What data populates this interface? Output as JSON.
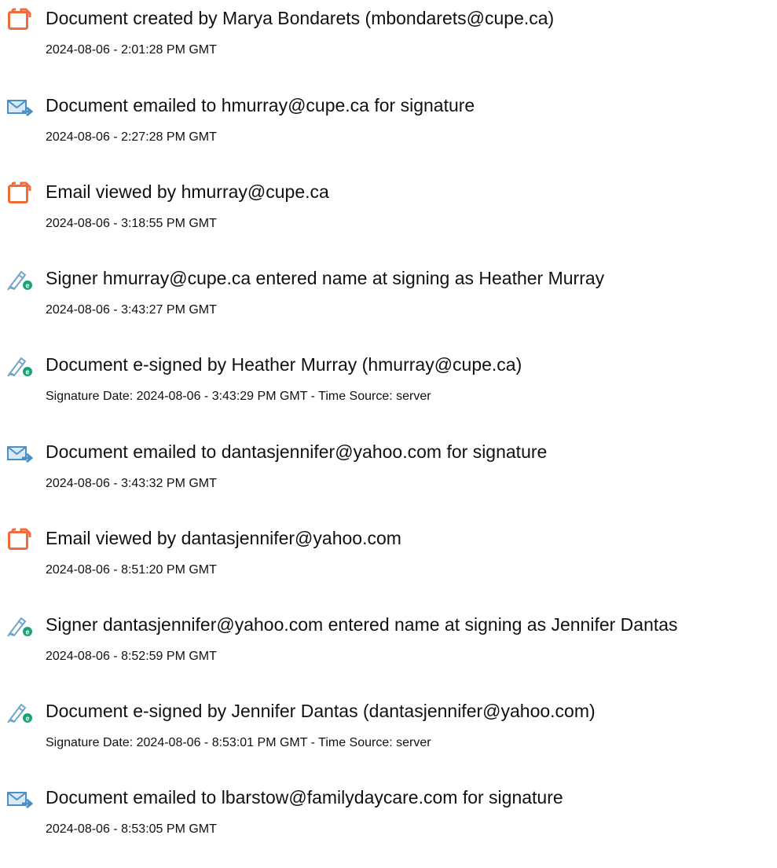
{
  "events": [
    {
      "icon": "document-created-icon",
      "title": "Document created by Marya Bondarets (mbondarets@cupe.ca)",
      "time": "2024-08-06 - 2:01:28 PM GMT"
    },
    {
      "icon": "email-sent-icon",
      "title": "Document emailed to hmurray@cupe.ca for signature",
      "time": "2024-08-06 - 2:27:28 PM GMT"
    },
    {
      "icon": "email-viewed-icon",
      "title": "Email viewed by hmurray@cupe.ca",
      "time": "2024-08-06 - 3:18:55 PM GMT"
    },
    {
      "icon": "e-sign-pen-icon",
      "title": "Signer hmurray@cupe.ca entered name at signing as Heather Murray",
      "time": "2024-08-06 - 3:43:27 PM GMT"
    },
    {
      "icon": "e-sign-pen-icon",
      "title": "Document e-signed by Heather Murray (hmurray@cupe.ca)",
      "time": "Signature Date: 2024-08-06 - 3:43:29 PM GMT - Time Source: server"
    },
    {
      "icon": "email-sent-icon",
      "title": "Document emailed to dantasjennifer@yahoo.com for signature",
      "time": "2024-08-06 - 3:43:32 PM GMT"
    },
    {
      "icon": "email-viewed-icon",
      "title": "Email viewed by dantasjennifer@yahoo.com",
      "time": "2024-08-06 - 8:51:20 PM GMT"
    },
    {
      "icon": "e-sign-pen-icon",
      "title": "Signer dantasjennifer@yahoo.com entered name at signing as Jennifer Dantas",
      "time": "2024-08-06 - 8:52:59 PM GMT"
    },
    {
      "icon": "e-sign-pen-icon",
      "title": "Document e-signed by Jennifer Dantas (dantasjennifer@yahoo.com)",
      "time": "Signature Date: 2024-08-06 - 8:53:01 PM GMT - Time Source: server"
    },
    {
      "icon": "email-sent-icon",
      "title": "Document emailed to lbarstow@familydaycare.com for signature",
      "time": "2024-08-06 - 8:53:05 PM GMT"
    }
  ],
  "colors": {
    "document_icon": "#f26b3a",
    "email_icon": "#4a90c8",
    "pen_icon": "#6fa5c9",
    "pen_badge": "#1aa37a"
  }
}
